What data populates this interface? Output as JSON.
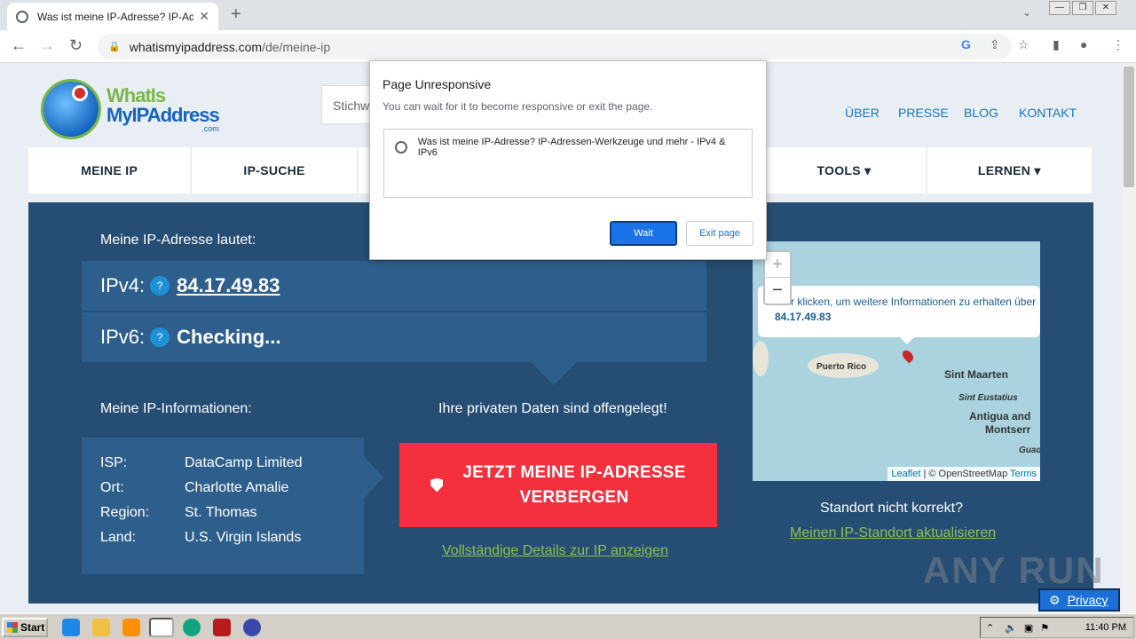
{
  "browser": {
    "tab_title": "Was ist meine IP-Adresse? IP-Adress",
    "tab_close": "✕",
    "new_tab": "+",
    "url_domain": "whatismyipaddress.com",
    "url_path": "/de/meine-ip",
    "win_buttons": [
      "—",
      "❐",
      "✕"
    ]
  },
  "site": {
    "logo_line1": "WhatIs",
    "logo_line2": "MyIPAddress",
    "logo_line3": ".com",
    "search_placeholder": "Stichw",
    "top_nav": [
      "ÜBER",
      "PRESSE",
      "BLOG",
      "KONTAKT"
    ],
    "main_nav": [
      "MEINE IP",
      "IP-SUCHE",
      "",
      "",
      "TOOLS ▾",
      "LERNEN ▾"
    ]
  },
  "hero": {
    "my_ip_label": "Meine IP-Adresse lautet:",
    "ipv4_label": "IPv4:",
    "ipv4_value": "84.17.49.83",
    "ipv6_label": "IPv6:",
    "ipv6_value": "Checking...",
    "qmark": "?",
    "info_label": "Meine IP-Informationen:",
    "private_label": "Ihre privaten Daten sind offengelegt!",
    "info": [
      {
        "k": "ISP:",
        "v": "DataCamp Limited"
      },
      {
        "k": "Ort:",
        "v": "Charlotte Amalie"
      },
      {
        "k": "Region:",
        "v": "St. Thomas"
      },
      {
        "k": "Land:",
        "v": "U.S. Virgin Islands"
      }
    ],
    "hide_line1": "JETZT MEINE IP-ADRESSE",
    "hide_line2": "VERBERGEN",
    "details_link": "Vollständige Details zur IP anzeigen",
    "location_wrong": "Standort nicht korrekt?",
    "update_location": "Meinen IP-Standort aktualisieren"
  },
  "map": {
    "zoom_in": "+",
    "zoom_out": "−",
    "popup_text": "Hier klicken, um weitere Informationen zu erhalten über",
    "popup_ip": "84.17.49.83",
    "labels": [
      "Puerto Rico",
      "Sint Maarten",
      "Sint Eustatius",
      "Antigua and",
      "Montserr",
      "Guad"
    ],
    "attr_leaflet": "Leaflet",
    "attr_osm": "| © OpenStreetMap",
    "attr_terms": "Terms"
  },
  "dialog": {
    "title": "Page Unresponsive",
    "subtitle": "You can wait for it to become responsive or exit the page.",
    "item": "Was ist meine IP-Adresse? IP-Adressen-Werkzeuge und mehr - IPv4 & IPv6",
    "wait": "Wait",
    "exit": "Exit page"
  },
  "watermark": "ANY RUN",
  "privacy": "Privacy",
  "taskbar": {
    "start": "Start",
    "clock": "11:40 PM"
  }
}
